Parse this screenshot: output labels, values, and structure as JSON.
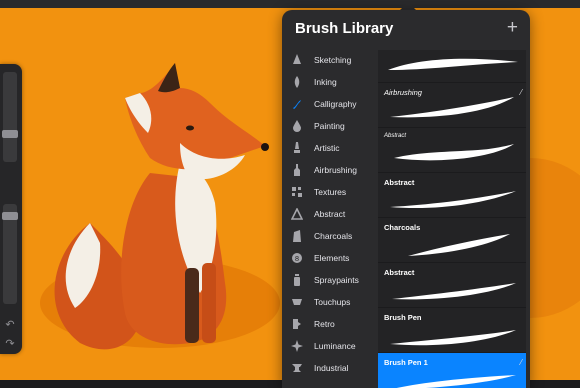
{
  "panel": {
    "title": "Brush Library",
    "add_label": "+"
  },
  "categories": [
    {
      "label": "Sketching",
      "icon": "pencil-tip-icon"
    },
    {
      "label": "Inking",
      "icon": "ink-nib-icon"
    },
    {
      "label": "Calligraphy",
      "icon": "calligraphy-icon",
      "accent": "#0a84ff"
    },
    {
      "label": "Painting",
      "icon": "paint-drop-icon"
    },
    {
      "label": "Artistic",
      "icon": "artistic-brush-icon"
    },
    {
      "label": "Airbrushing",
      "icon": "airbrush-icon"
    },
    {
      "label": "Textures",
      "icon": "texture-icon"
    },
    {
      "label": "Abstract",
      "icon": "triangle-icon"
    },
    {
      "label": "Charcoals",
      "icon": "charcoal-icon"
    },
    {
      "label": "Elements",
      "icon": "elements-icon"
    },
    {
      "label": "Spraypaints",
      "icon": "spraycan-icon"
    },
    {
      "label": "Touchups",
      "icon": "touchup-icon"
    },
    {
      "label": "Retro",
      "icon": "retro-icon"
    },
    {
      "label": "Luminance",
      "icon": "sparkle-icon"
    },
    {
      "label": "Industrial",
      "icon": "anvil-icon"
    }
  ],
  "brushes": [
    {
      "name": "",
      "style": "normal"
    },
    {
      "name": "Airbrushing",
      "style": "italic"
    },
    {
      "name": "Abstract",
      "style": "small"
    },
    {
      "name": "Abstract",
      "style": "normal"
    },
    {
      "name": "Charcoals",
      "style": "normal"
    },
    {
      "name": "Abstract",
      "style": "normal"
    },
    {
      "name": "Brush Pen",
      "style": "normal"
    },
    {
      "name": "Brush Pen 1",
      "style": "normal",
      "selected": true
    }
  ],
  "colors": {
    "accent": "#0a84ff",
    "canvas": "#f2920f",
    "panel": "#2b2b2d"
  }
}
